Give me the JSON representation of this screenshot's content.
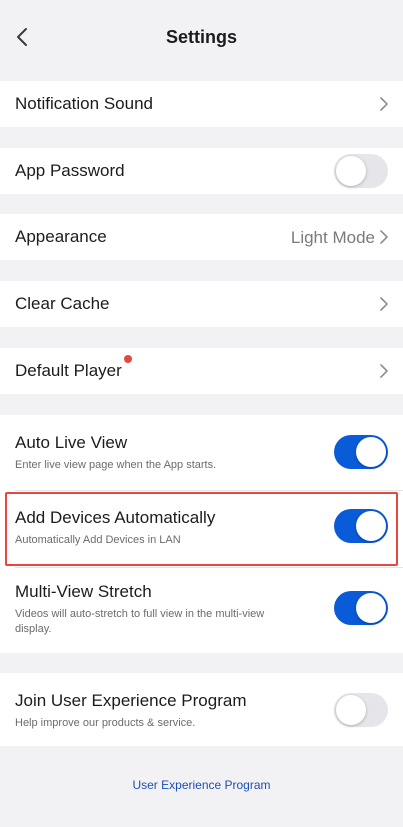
{
  "header": {
    "title": "Settings"
  },
  "rows": {
    "notification_sound": {
      "label": "Notification Sound"
    },
    "app_password": {
      "label": "App Password",
      "toggle": false
    },
    "appearance": {
      "label": "Appearance",
      "value": "Light Mode"
    },
    "clear_cache": {
      "label": "Clear Cache"
    },
    "default_player": {
      "label": "Default Player",
      "badge": true
    },
    "auto_live_view": {
      "label": "Auto Live View",
      "subtitle": "Enter live view page when the App starts.",
      "toggle": true
    },
    "add_devices": {
      "label": "Add Devices Automatically",
      "subtitle": "Automatically Add Devices in LAN",
      "toggle": true
    },
    "multi_view": {
      "label": "Multi-View Stretch",
      "subtitle": "Videos will auto-stretch to full view in the multi-view display.",
      "toggle": true
    },
    "join_program": {
      "label": "Join User Experience Program",
      "subtitle": "Help improve our products & service.",
      "toggle": false
    }
  },
  "footer": {
    "link": "User Experience Program"
  },
  "colors": {
    "accent": "#0a5bd8",
    "highlight": "#e8463e",
    "badge": "#e04a3f",
    "link": "#1b4fb8"
  }
}
